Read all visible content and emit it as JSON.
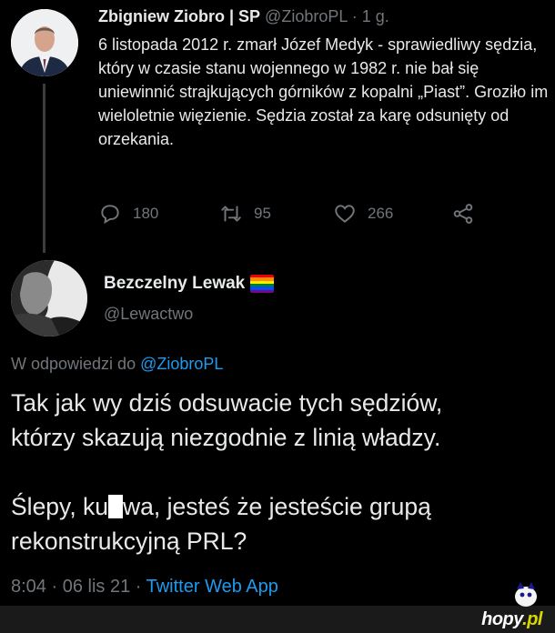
{
  "tweet1": {
    "author_name": "Zbigniew Ziobro | SP",
    "handle": "@ZiobroPL",
    "time": " · 1 g.",
    "body": "6 listopada 2012 r. zmarł Józef Medyk - sprawiedliwy sędzia, który w czasie stanu wojennego w 1982 r. nie bał się uniewinnić strajkujących górników z kopalni „Piast”. Groziło im wieloletnie więzienie. Sędzia został za karę odsunięty od orzekania.",
    "replies": "180",
    "retweets": "95",
    "likes": "266"
  },
  "tweet2": {
    "author_name": "Bezczelny Lewak",
    "handle": "@Lewactwo",
    "reply_prefix": "W odpowiedzi do ",
    "reply_mention": "@ZiobroPL",
    "line1": "Tak jak wy dziś odsuwacie tych sędziów,",
    "line2": "którzy skazują niezgodnie z linią władzy.",
    "line3_a": "Ślepy, ku",
    "line3_b": "wa, jesteś że jesteście grupą",
    "line4": "rekonstrukcyjną PRL?",
    "time": "8:04 · 06 lis 21 · ",
    "app": "Twitter Web App"
  },
  "watermark": {
    "text": "hopy",
    "suffix": ".pl"
  },
  "colors": {
    "background": "#000000",
    "text": "#e7e9ea",
    "muted": "#71767b",
    "link": "#1d9bf0",
    "rainbow": [
      "#e40303",
      "#ff8c00",
      "#ffed00",
      "#008026",
      "#004dff",
      "#750787"
    ]
  },
  "icons": [
    "reply-icon",
    "retweet-icon",
    "like-icon",
    "share-icon"
  ]
}
